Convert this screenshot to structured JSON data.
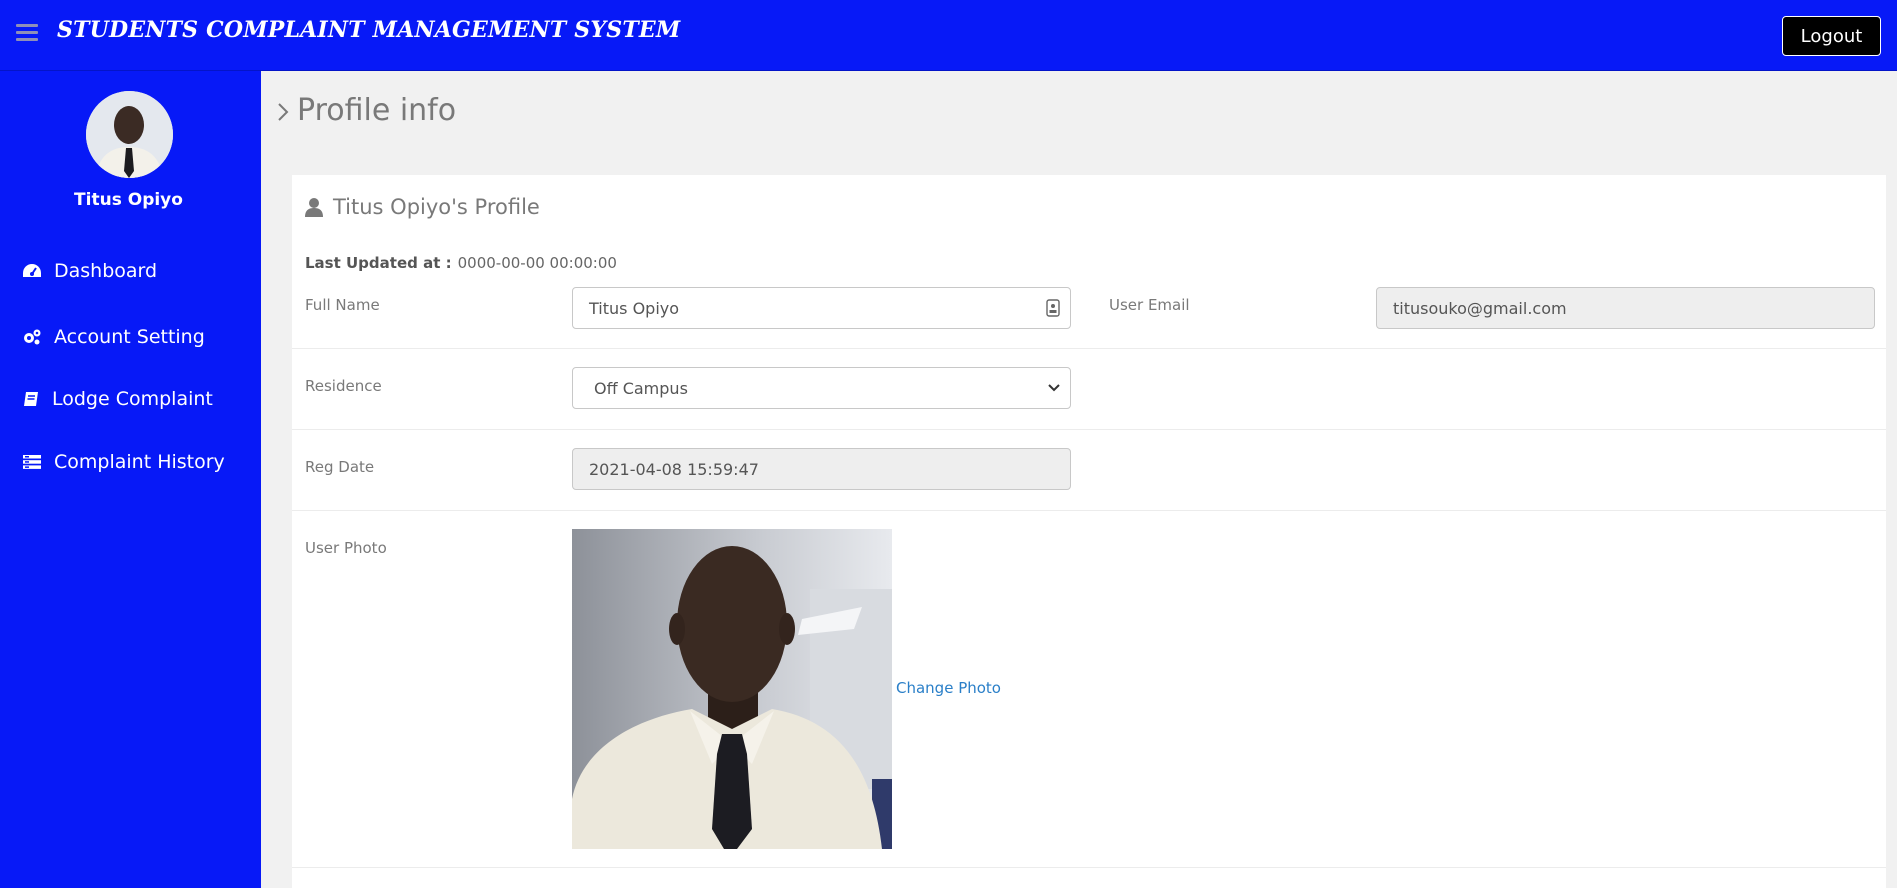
{
  "header": {
    "app_title": "STUDENTS COMPLAINT MANAGEMENT SYSTEM",
    "logout_label": "Logout",
    "bg_color": "#0719f7"
  },
  "sidebar": {
    "user_name": "Titus Opiyo",
    "items": [
      {
        "label": "Dashboard",
        "icon": "dashboard-icon"
      },
      {
        "label": "Account Setting",
        "icon": "gears-icon"
      },
      {
        "label": "Lodge Complaint",
        "icon": "book-icon"
      },
      {
        "label": "Complaint History",
        "icon": "list-icon"
      }
    ]
  },
  "page": {
    "breadcrumb": "Profile info",
    "panel_title": "Titus Opiyo's Profile",
    "last_updated_label": "Last Updated at :",
    "last_updated_value": "0000-00-00 00:00:00"
  },
  "form": {
    "full_name_label": "Full Name",
    "full_name_value": "Titus Opiyo",
    "email_label": "User Email",
    "email_value": "titusouko@gmail.com",
    "residence_label": "Residence",
    "residence_value": "Off Campus",
    "reg_date_label": "Reg Date",
    "reg_date_value": "2021-04-08 15:59:47",
    "photo_label": "User Photo",
    "change_photo_label": "Change Photo"
  },
  "colors": {
    "accent": "#0719f7",
    "link": "#2a7fc8"
  }
}
